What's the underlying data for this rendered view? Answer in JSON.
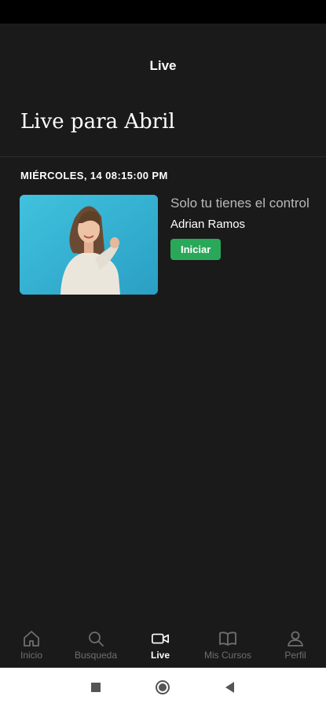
{
  "header": {
    "title": "Live"
  },
  "section": {
    "title": "Live para Abril"
  },
  "schedule": {
    "date_label": "MIÉRCOLES, 14 08:15:00 PM"
  },
  "live_card": {
    "title": "Solo tu tienes el control",
    "host": "Adrian Ramos",
    "start_label": "Iniciar"
  },
  "bottom_nav": {
    "items": [
      {
        "label": "Inicio",
        "icon": "home-icon",
        "active": false
      },
      {
        "label": "Busqueda",
        "icon": "search-icon",
        "active": false
      },
      {
        "label": "Live",
        "icon": "video-icon",
        "active": true
      },
      {
        "label": "Mis Cursos",
        "icon": "book-icon",
        "active": false
      },
      {
        "label": "Perfil",
        "icon": "user-icon",
        "active": false
      }
    ]
  },
  "colors": {
    "background": "#1a1a1a",
    "accent": "#2aa85a",
    "inactive": "#6f6f6f"
  }
}
